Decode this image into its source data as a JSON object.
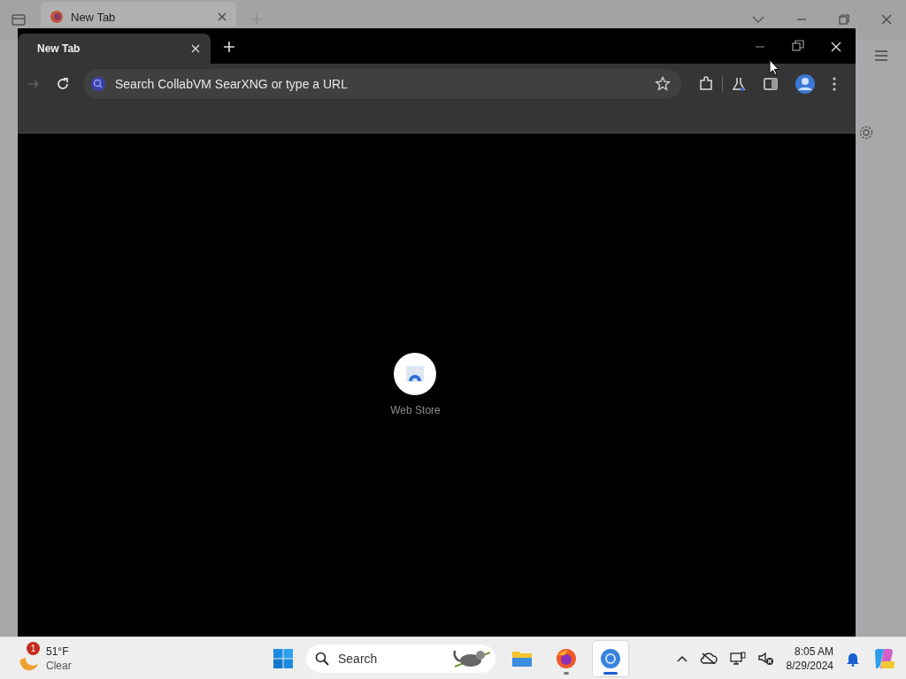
{
  "background_browser": {
    "tab": {
      "title": "New Tab"
    }
  },
  "browser": {
    "tab": {
      "title": "New Tab"
    },
    "address_bar": {
      "placeholder": "Search CollabVM SearXNG or type a URL"
    },
    "shortcuts": [
      {
        "title": "Web Store"
      }
    ]
  },
  "taskbar": {
    "weather": {
      "badge": "1",
      "temperature": "51°F",
      "condition": "Clear"
    },
    "search": {
      "placeholder": "Search"
    },
    "apps": [
      {
        "kind": "files",
        "running": false,
        "selected": false
      },
      {
        "kind": "firefox",
        "running": true,
        "selected": false
      },
      {
        "kind": "chrome",
        "running": true,
        "selected": true
      }
    ],
    "clock": {
      "time": "8:05 AM",
      "date": "8/29/2024"
    }
  }
}
